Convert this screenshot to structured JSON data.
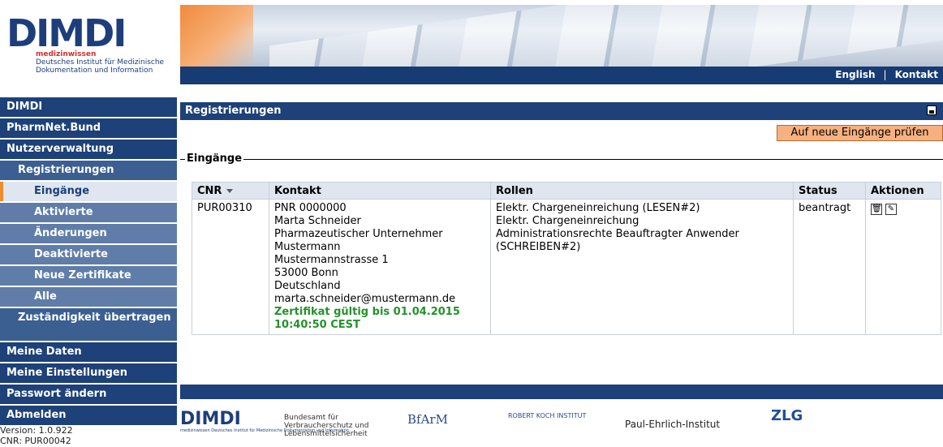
{
  "logo": {
    "mark": "DIMDI",
    "tagline_red": "medizinwissen",
    "tagline_line1": "Deutsches Institut für Medizinische",
    "tagline_line2": "Dokumentation und Information"
  },
  "topnav": {
    "english": "English",
    "kontakt": "Kontakt"
  },
  "sidebar": {
    "items": [
      {
        "label": "DIMDI"
      },
      {
        "label": "PharmNet.Bund"
      },
      {
        "label": "Nutzerverwaltung"
      },
      {
        "label": "Registrierungen"
      },
      {
        "label": "Eingänge"
      },
      {
        "label": "Aktivierte"
      },
      {
        "label": "Änderungen"
      },
      {
        "label": "Deaktivierte"
      },
      {
        "label": "Neue Zertifikate"
      },
      {
        "label": "Alle"
      },
      {
        "label": "Zuständigkeit übertragen"
      },
      {
        "label": "Meine Daten"
      },
      {
        "label": "Meine Einstellungen"
      },
      {
        "label": "Passwort ändern"
      },
      {
        "label": "Abmelden"
      }
    ],
    "version": "Version: 1.0.922",
    "cnr": "CNR: PUR00042"
  },
  "page": {
    "title": "Registrierungen",
    "check_button": "Auf neue Eingänge prüfen",
    "section_legend": "Eingänge"
  },
  "table": {
    "headers": [
      "CNR",
      "Kontakt",
      "Rollen",
      "Status",
      "Aktionen"
    ],
    "rows": [
      {
        "cnr": "PUR00310",
        "contact": [
          "PNR 0000000",
          "Marta Schneider",
          "Pharmazeutischer Unternehmer",
          "Mustermann",
          "Mustermannstrasse 1",
          "53000 Bonn",
          "Deutschland",
          "marta.schneider@mustermann.de"
        ],
        "certificate": "Zertifikat gültig bis 01.04.2015 10:40:50 CEST",
        "roles": [
          "Elektr. Chargeneinreichung (LESEN#2)",
          "Elektr. Chargeneinreichung",
          "Administrationsrechte Beauftragter Anwender",
          "(SCHREIBEN#2)"
        ],
        "status": "beantragt"
      }
    ]
  },
  "footer": {
    "dimdi": "DIMDI",
    "dimdi_sub": "medizinwissen Deutsches Institut für Medizinische Dokumentation und Information",
    "bund_line1": "Bundesamt für",
    "bund_line2": "Verbraucherschutz und",
    "bund_line3": "Lebensmittelsicherheit",
    "bfarm": "BfArM",
    "rki": "ROBERT KOCH INSTITUT",
    "pei": "Paul-Ehrlich-Institut",
    "zlg": "ZLG"
  },
  "colors": {
    "nav": "#1d4178",
    "accent": "#f08a2c",
    "cert": "#23922a",
    "button": "#f7b07f"
  }
}
